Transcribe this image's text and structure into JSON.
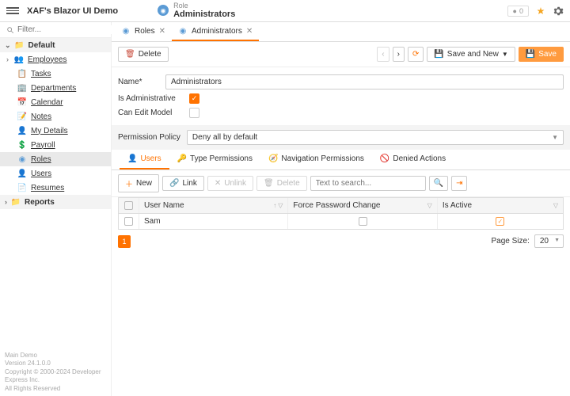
{
  "app": {
    "title": "XAF's Blazor UI Demo"
  },
  "header": {
    "breadcrumb_top": "Role",
    "breadcrumb_bottom": "Administrators",
    "counter": "0"
  },
  "search": {
    "placeholder": "Filter..."
  },
  "sidebar": {
    "groups": {
      "default": "Default",
      "reports": "Reports"
    },
    "items": {
      "employees": "Employees",
      "tasks": "Tasks",
      "departments": "Departments",
      "calendar": "Calendar",
      "notes": "Notes",
      "my_details": "My Details",
      "payroll": "Payroll",
      "roles": "Roles",
      "users": "Users",
      "resumes": "Resumes"
    }
  },
  "tabs": {
    "roles": "Roles",
    "administrators": "Administrators"
  },
  "toolbar": {
    "delete": "Delete",
    "save_and_new": "Save and New",
    "save": "Save"
  },
  "form": {
    "name_label": "Name*",
    "name_value": "Administrators",
    "is_admin_label": "Is Administrative",
    "can_edit_label": "Can Edit Model",
    "perm_policy_label": "Permission Policy",
    "perm_policy_value": "Deny all by default"
  },
  "sub_tabs": {
    "users": "Users",
    "type_perms": "Type Permissions",
    "nav_perms": "Navigation Permissions",
    "denied": "Denied Actions"
  },
  "grid_toolbar": {
    "new": "New",
    "link": "Link",
    "unlink": "Unlink",
    "delete": "Delete",
    "search_placeholder": "Text to search..."
  },
  "grid": {
    "cols": {
      "user_name": "User Name",
      "force_pw": "Force Password Change",
      "is_active": "Is Active"
    },
    "row1": {
      "user_name": "Sam"
    }
  },
  "pager": {
    "page": "1",
    "page_size_label": "Page Size:",
    "page_size_value": "20"
  },
  "footer": {
    "l1": "Main Demo",
    "l2": "Version 24.1.0.0",
    "l3": "Copyright © 2000-2024 Developer Express Inc.",
    "l4": "All Rights Reserved"
  }
}
